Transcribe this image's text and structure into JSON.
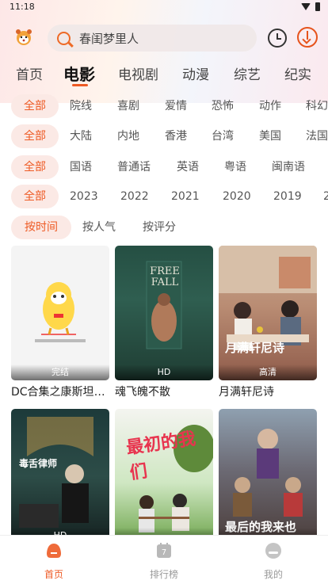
{
  "status_bar": {
    "time": "11:18"
  },
  "search": {
    "value": "春闺梦里人"
  },
  "tabs": [
    {
      "label": "首页"
    },
    {
      "label": "电影"
    },
    {
      "label": "电视剧"
    },
    {
      "label": "动漫"
    },
    {
      "label": "综艺"
    },
    {
      "label": "纪实"
    }
  ],
  "filters": {
    "genre": [
      "全部",
      "院线",
      "喜剧",
      "爱情",
      "恐怖",
      "动作",
      "科幻"
    ],
    "region": [
      "全部",
      "大陆",
      "内地",
      "香港",
      "台湾",
      "美国",
      "法国"
    ],
    "language": [
      "全部",
      "国语",
      "普通话",
      "英语",
      "粤语",
      "闽南语"
    ],
    "year": [
      "全部",
      "2023",
      "2022",
      "2021",
      "2020",
      "2019",
      "2"
    ],
    "sort": [
      "按时间",
      "按人气",
      "按评分"
    ]
  },
  "movies": [
    {
      "title": "DC合集之康斯坦丁...",
      "badge": "完结",
      "poster_text": ""
    },
    {
      "title": "魂飞魄不散",
      "badge": "HD",
      "poster_text": "FREE FALL"
    },
    {
      "title": "月满轩尼诗",
      "badge": "高清",
      "poster_text": "月满轩尼诗"
    },
    {
      "title": "",
      "badge": "HD",
      "poster_text": "毒舌律师"
    },
    {
      "title": "",
      "badge": "",
      "poster_text": "最初的我们"
    },
    {
      "title": "",
      "badge": "",
      "poster_text": "最后的我来也"
    }
  ],
  "bottom_nav": [
    {
      "label": "首页"
    },
    {
      "label": "排行榜"
    },
    {
      "label": "我的"
    }
  ],
  "colors": {
    "accent": "#ee5a24",
    "chip_bg": "#fbe9e5"
  }
}
